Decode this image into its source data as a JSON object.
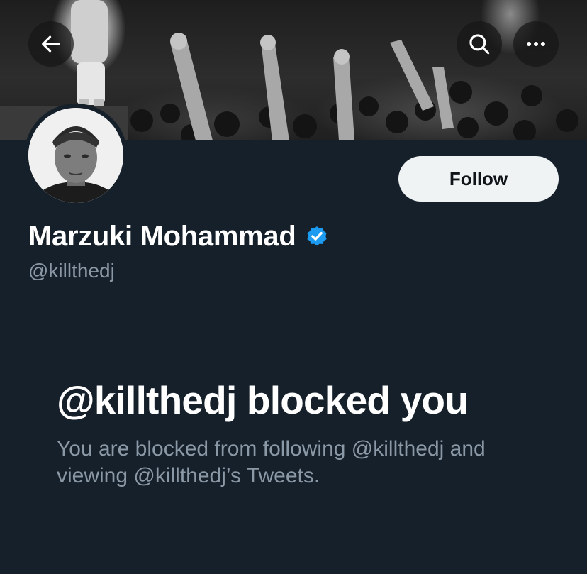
{
  "header": {
    "back_icon": "arrow-left-icon",
    "search_icon": "search-icon",
    "more_icon": "more-horizontal-icon"
  },
  "profile": {
    "display_name": "Marzuki Mohammad",
    "handle": "@killthedj",
    "verified": true,
    "verified_color": "#1d9bf0",
    "follow_label": "Follow"
  },
  "blocked": {
    "title": "@killthedj blocked you",
    "description": "You are blocked from following @killthedj and viewing @killthedj’s Tweets."
  },
  "colors": {
    "background": "#15202b",
    "secondary_text": "#8b98a5",
    "follow_button_bg": "#eff3f4"
  }
}
